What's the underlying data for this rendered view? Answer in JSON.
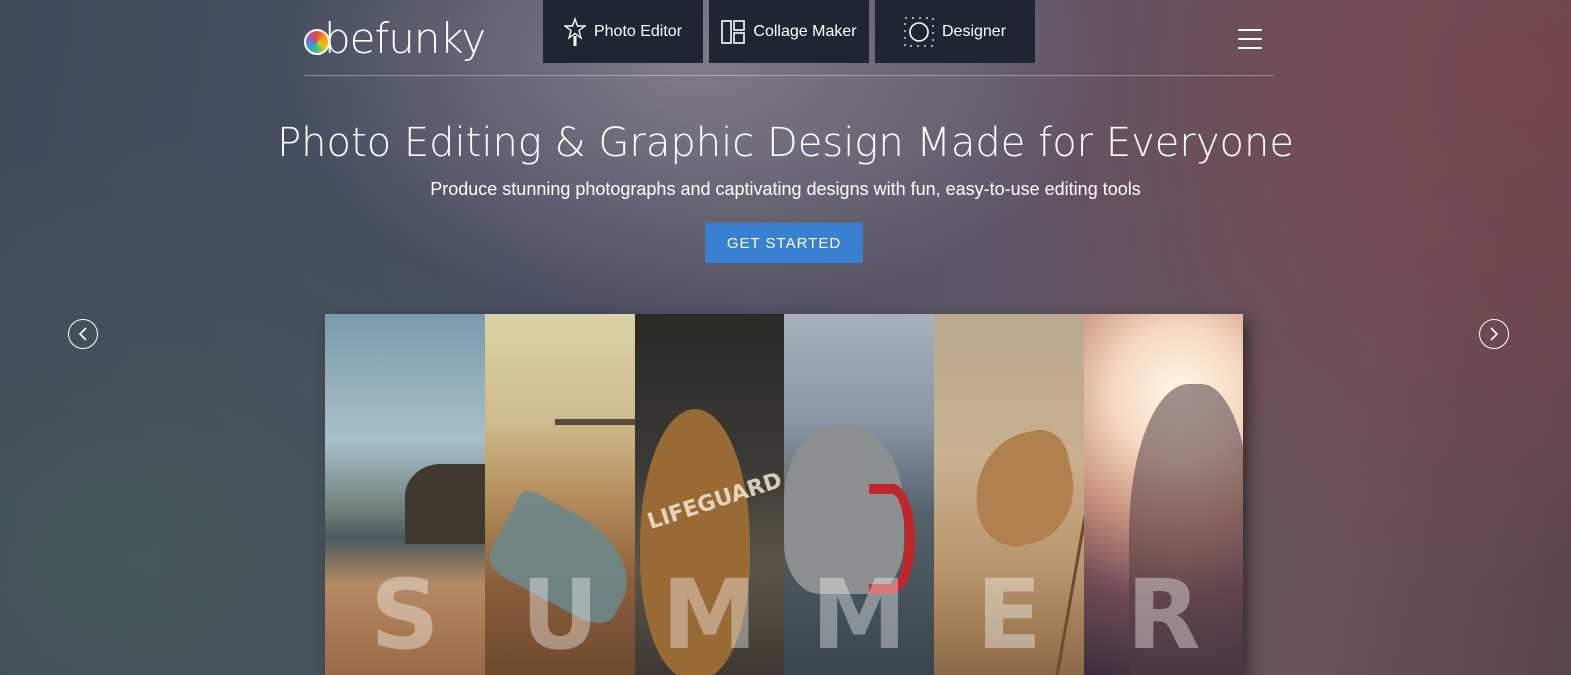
{
  "header": {
    "logo_text": "befunky",
    "nav": [
      {
        "label": "Photo Editor",
        "icon": "star-wand-icon"
      },
      {
        "label": "Collage Maker",
        "icon": "collage-grid-icon"
      },
      {
        "label": "Designer",
        "icon": "designer-circle-icon"
      }
    ],
    "menu_icon": "hamburger-menu-icon"
  },
  "hero": {
    "title": "Photo Editing & Graphic Design Made for Everyone",
    "subtitle": "Produce stunning photographs and captivating designs with fun, easy-to-use editing tools",
    "cta_label": "GET STARTED"
  },
  "carousel": {
    "prev_icon": "chevron-left-circle-icon",
    "next_icon": "chevron-right-circle-icon",
    "panels": [
      {
        "letter": "S"
      },
      {
        "letter": "U"
      },
      {
        "letter": "M",
        "text": "LIFEGUARD"
      },
      {
        "letter": "M"
      },
      {
        "letter": "E"
      },
      {
        "letter": "R"
      }
    ]
  },
  "colors": {
    "nav_bg": "#1f2632",
    "cta_bg": "#3a80d2"
  }
}
